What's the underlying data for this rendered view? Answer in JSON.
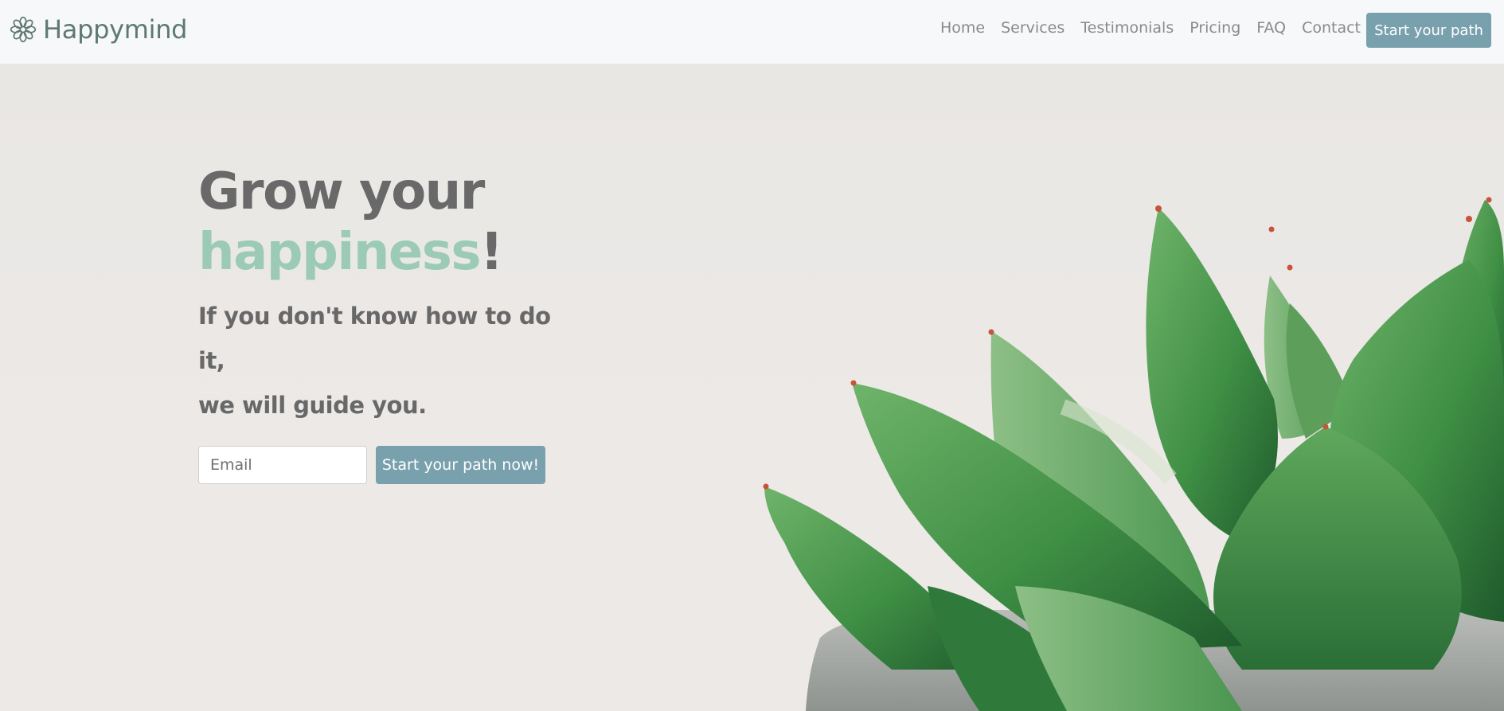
{
  "brand": {
    "icon": "flower-icon",
    "name": "Happymind"
  },
  "nav": {
    "links": [
      "Home",
      "Services",
      "Testimonials",
      "Pricing",
      "FAQ",
      "Contact"
    ],
    "cta_label": "Start your path"
  },
  "hero": {
    "title_line1": "Grow your",
    "title_accent": "happiness",
    "title_punct": "!",
    "subtitle_line1": "If you don't know how to do it,",
    "subtitle_line2": "we will guide you.",
    "email_placeholder": "Email",
    "email_value": "",
    "submit_label": "Start your path now!",
    "image": "succulent-plant-photo"
  },
  "colors": {
    "accent": "#79a0ad",
    "highlight": "#9bcbb6",
    "brand": "#5e7872",
    "text": "#696969",
    "navbar_bg": "#f7f8f9",
    "hero_bg": "#ebe8e6"
  }
}
